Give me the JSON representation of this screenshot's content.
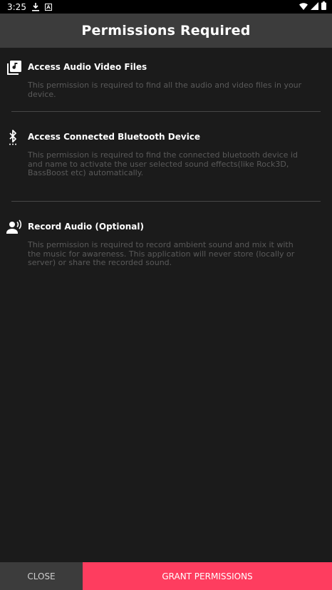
{
  "status_bar": {
    "time": "3:25",
    "icons": [
      "download-icon",
      "a11y-icon",
      "wifi-icon",
      "signal-icon",
      "battery-icon"
    ]
  },
  "app_bar": {
    "title": "Permissions Required"
  },
  "permissions": [
    {
      "icon": "audio-video-files-icon",
      "title": "Access Audio Video Files",
      "description": "This permission is required to find all the audio and video files in your device."
    },
    {
      "icon": "bluetooth-icon",
      "title": "Access Connected Bluetooth Device",
      "description": "This permission is required to find the connected bluetooth device id and name to activate the user selected sound effects(like Rock3D, BassBoost etc) automatically."
    },
    {
      "icon": "record-voice-icon",
      "title": "Record Audio (Optional)",
      "description": "This permission is required to record ambient sound and mix it with the music for awareness. This application will never store (locally or server) or share the recorded sound."
    }
  ],
  "buttons": {
    "close_label": "CLOSE",
    "grant_label": "GRANT PERMISSIONS"
  },
  "colors": {
    "background": "#1b1b1b",
    "app_bar": "#3c3c3c",
    "accent": "#fe3d5f",
    "description_text": "#5a5a5a",
    "divider": "#474747"
  }
}
